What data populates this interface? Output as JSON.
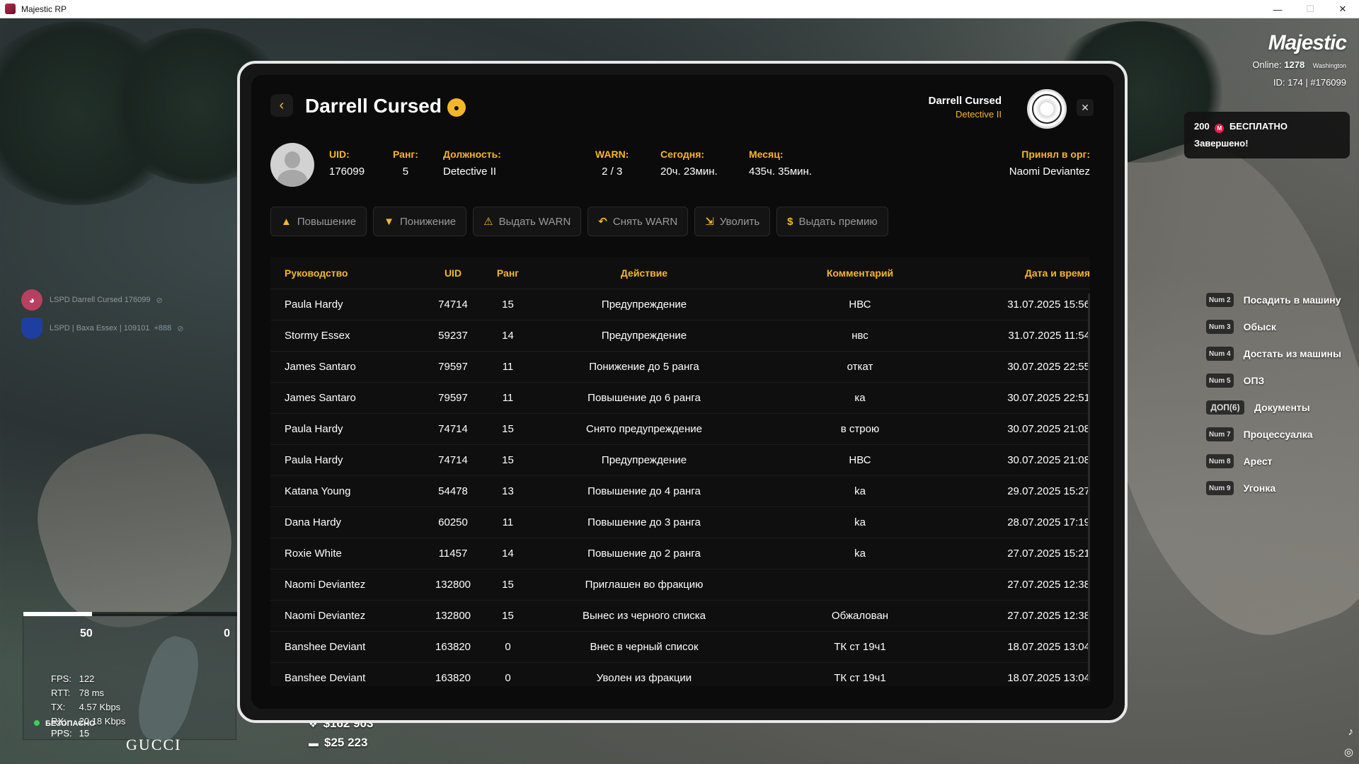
{
  "window": {
    "title": "Majestic RP",
    "controls": [
      "—",
      "☐",
      "✕"
    ]
  },
  "hud": {
    "brand": "Majestic",
    "online_label": "Online:",
    "online_count": "1278",
    "server": "Washington",
    "id_line": "ID: 174 | #176099",
    "notification": {
      "amount": "200",
      "coin": "M",
      "label": "БЕСПЛАТНО",
      "status": "Завершено!"
    },
    "hotkeys": [
      {
        "key": "Num 2",
        "label": "Посадить в машину"
      },
      {
        "key": "Num 3",
        "label": "Обыск"
      },
      {
        "key": "Num 4",
        "label": "Достать из машины"
      },
      {
        "key": "Num 5",
        "label": "ОПЗ"
      },
      {
        "key": "ДОП(6)",
        "label": "Документы"
      },
      {
        "key": "Num 7",
        "label": "Процессуалка"
      },
      {
        "key": "Num 8",
        "label": "Арест"
      },
      {
        "key": "Num 9",
        "label": "Угонка"
      }
    ],
    "voice": [
      {
        "text": "LSPD Darrell Cursed 176099",
        "badge": ""
      },
      {
        "text": "LSPD | Baxa Essex | 109101",
        "badge": "+888"
      }
    ],
    "speed_left": "50",
    "speed_right": "0",
    "speed_progress": 0.32,
    "stats": [
      {
        "k": "FPS:",
        "v": "122"
      },
      {
        "k": "RTT:",
        "v": "78 ms"
      },
      {
        "k": "TX:",
        "v": "4.57 Kbps"
      },
      {
        "k": "RX:",
        "v": "20.18 Kbps"
      }
    ],
    "safe_zone": "БЕЗОПАСНО",
    "pps_label": "PPS:",
    "pps_value": "15",
    "zone_name": "GUCCI",
    "cash": "$162 903",
    "bank": "$25 223"
  },
  "panel": {
    "name": "Darrell Cursed",
    "header_name": "Darrell Cursed",
    "header_rank": "Detective II",
    "fields": [
      {
        "label": "UID:",
        "value": "176099"
      },
      {
        "label": "Ранг:",
        "value": "5"
      },
      {
        "label": "Должность:",
        "value": "Detective II"
      },
      {
        "label": "WARN:",
        "value": "2 / 3"
      },
      {
        "label": "Сегодня:",
        "value": "20ч. 23мин."
      },
      {
        "label": "Месяц:",
        "value": "435ч. 35мин."
      },
      {
        "label": "Принял в орг:",
        "value": "Naomi Deviantez"
      }
    ],
    "actions": [
      {
        "icon": "▲",
        "label": "Повышение"
      },
      {
        "icon": "▼",
        "label": "Понижение"
      },
      {
        "icon": "⚠",
        "label": "Выдать WARN"
      },
      {
        "icon": "↶",
        "label": "Снять WARN"
      },
      {
        "icon": "⇲",
        "label": "Уволить"
      },
      {
        "icon": "$",
        "label": "Выдать премию"
      }
    ],
    "table": {
      "headers": [
        "Руководство",
        "UID",
        "Ранг",
        "Действие",
        "Комментарий",
        "Дата и время"
      ],
      "rows": [
        [
          "Paula Hardy",
          "74714",
          "15",
          "Предупреждение",
          "НВС",
          "31.07.2025 15:56"
        ],
        [
          "Stormy Essex",
          "59237",
          "14",
          "Предупреждение",
          "нвс",
          "31.07.2025 11:54"
        ],
        [
          "James Santaro",
          "79597",
          "11",
          "Понижение до 5 ранга",
          "откат",
          "30.07.2025 22:55"
        ],
        [
          "James Santaro",
          "79597",
          "11",
          "Повышение до 6 ранга",
          "ка",
          "30.07.2025 22:51"
        ],
        [
          "Paula Hardy",
          "74714",
          "15",
          "Снято предупреждение",
          "в строю",
          "30.07.2025 21:08"
        ],
        [
          "Paula Hardy",
          "74714",
          "15",
          "Предупреждение",
          "НВС",
          "30.07.2025 21:08"
        ],
        [
          "Katana Young",
          "54478",
          "13",
          "Повышение до 4 ранга",
          "ka",
          "29.07.2025 15:27"
        ],
        [
          "Dana Hardy",
          "60250",
          "11",
          "Повышение до 3 ранга",
          "ka",
          "28.07.2025 17:19"
        ],
        [
          "Roxie White",
          "11457",
          "14",
          "Повышение до 2 ранга",
          "ka",
          "27.07.2025 15:21"
        ],
        [
          "Naomi Deviantez",
          "132800",
          "15",
          "Приглашен во фракцию",
          "",
          "27.07.2025 12:38"
        ],
        [
          "Naomi Deviantez",
          "132800",
          "15",
          "Вынес из черного списка",
          "Обжалован",
          "27.07.2025 12:38"
        ],
        [
          "Banshee Deviant",
          "163820",
          "0",
          "Внес в черный список",
          "ТК ст 19ч1",
          "18.07.2025 13:04"
        ],
        [
          "Banshee Deviant",
          "163820",
          "0",
          "Уволен из фракции",
          "ТК ст 19ч1",
          "18.07.2025 13:04"
        ]
      ]
    }
  },
  "colors": {
    "accent": "#f5b72a",
    "panel_bg": "#0b0b0b",
    "frame": "#e8e8e8"
  }
}
